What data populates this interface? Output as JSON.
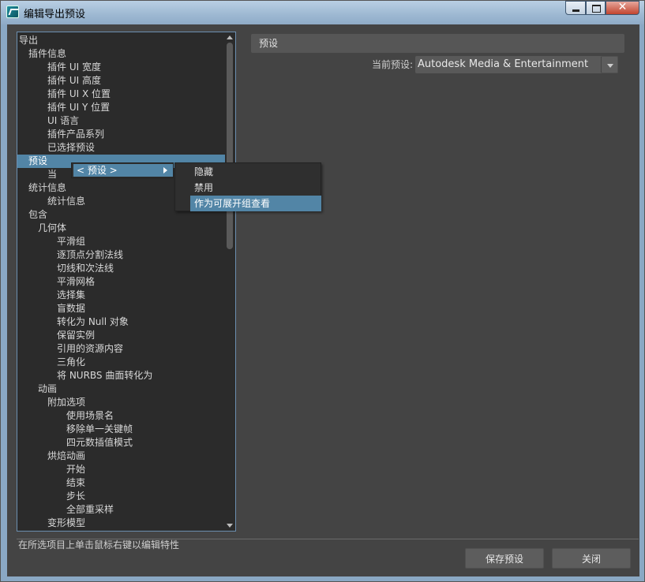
{
  "window": {
    "title": "编辑导出预设"
  },
  "tree": {
    "items": [
      {
        "label": "导出",
        "level": 0
      },
      {
        "label": "插件信息",
        "level": 1
      },
      {
        "label": "插件 UI 宽度",
        "level": 3
      },
      {
        "label": "插件 UI 高度",
        "level": 3
      },
      {
        "label": "插件 UI X 位置",
        "level": 3
      },
      {
        "label": "插件 UI Y 位置",
        "level": 3
      },
      {
        "label": "UI 语言",
        "level": 3
      },
      {
        "label": "插件产品系列",
        "level": 3
      },
      {
        "label": "已选择预设",
        "level": 3
      },
      {
        "label": "预设",
        "level": 1,
        "selected": true
      },
      {
        "label": "当",
        "level": 3
      },
      {
        "label": "统计信息",
        "level": 1
      },
      {
        "label": "统计信息",
        "level": 3
      },
      {
        "label": "包含",
        "level": 1
      },
      {
        "label": "几何体",
        "level": 2
      },
      {
        "label": "平滑组",
        "level": 4
      },
      {
        "label": "逐顶点分割法线",
        "level": 4
      },
      {
        "label": "切线和次法线",
        "level": 4
      },
      {
        "label": "平滑网格",
        "level": 4
      },
      {
        "label": "选择集",
        "level": 4
      },
      {
        "label": "盲数据",
        "level": 4
      },
      {
        "label": "转化为 Null 对象",
        "level": 4
      },
      {
        "label": "保留实例",
        "level": 4
      },
      {
        "label": "引用的资源内容",
        "level": 4
      },
      {
        "label": "三角化",
        "level": 4
      },
      {
        "label": "将 NURBS 曲面转化为",
        "level": 4
      },
      {
        "label": "动画",
        "level": 2
      },
      {
        "label": "附加选项",
        "level": 3
      },
      {
        "label": "使用场景名",
        "level": 5
      },
      {
        "label": "移除单一关键帧",
        "level": 5
      },
      {
        "label": "四元数插值模式",
        "level": 5
      },
      {
        "label": "烘焙动画",
        "level": 3
      },
      {
        "label": "开始",
        "level": 5
      },
      {
        "label": "结束",
        "level": 5
      },
      {
        "label": "步长",
        "level": 5
      },
      {
        "label": "全部重采样",
        "level": 5
      },
      {
        "label": "变形模型",
        "level": 3
      }
    ]
  },
  "right_panel": {
    "header": "预设",
    "current_preset_label": "当前预设:",
    "current_preset_value": "Autodesk Media & Entertainment"
  },
  "context_menu": {
    "item_label": "< 预设 >",
    "submenu": [
      "隐藏",
      "禁用",
      "作为可展开组查看"
    ],
    "submenu_active_index": 2
  },
  "footer": {
    "hint": "在所选项目上单击鼠标右键以编辑特性",
    "save_label": "保存预设",
    "close_label": "关闭"
  }
}
